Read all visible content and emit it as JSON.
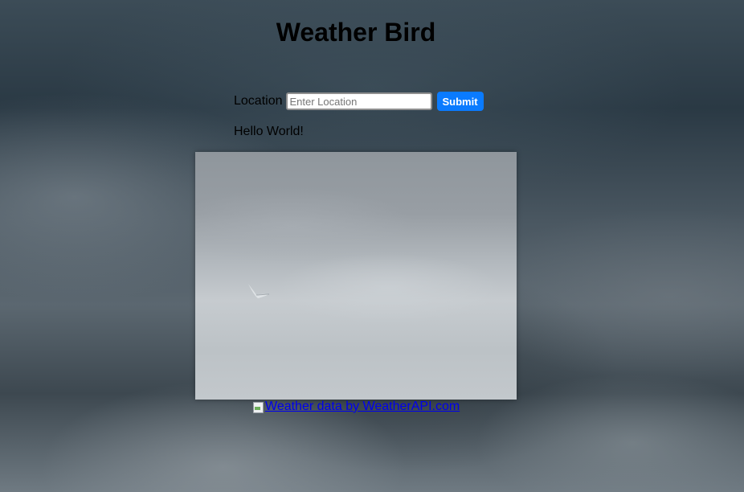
{
  "header": {
    "title": "Weather Bird"
  },
  "form": {
    "location_label": "Location",
    "location_placeholder": "Enter Location",
    "location_value": "",
    "submit_label": "Submit"
  },
  "result": {
    "message": "Hello World!"
  },
  "image": {
    "subject": "bird flying in cloudy sky"
  },
  "footer": {
    "api_link_text": "Weather data by WeatherAPI.com",
    "broken_image_icon": "broken-image-icon"
  },
  "colors": {
    "submit_button": "#0a7bff",
    "link": "#0000ee"
  }
}
